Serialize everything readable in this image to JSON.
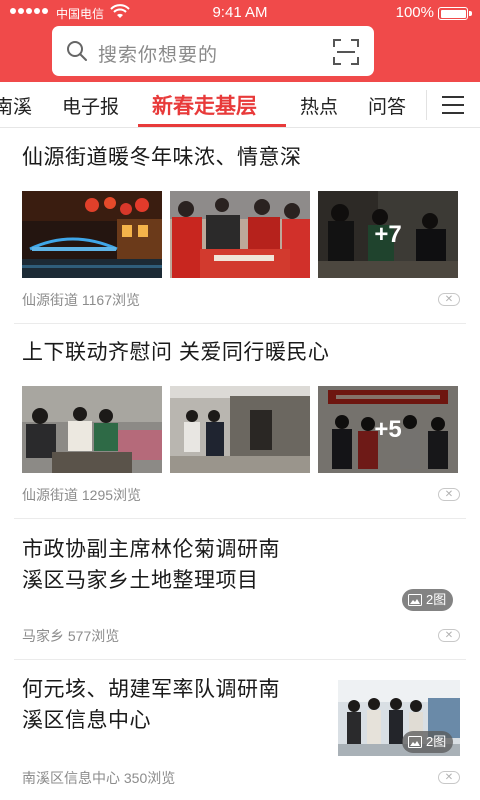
{
  "status_bar": {
    "carrier": "中国电信",
    "time": "9:41 AM",
    "battery": "100%",
    "battery_level": 1.0
  },
  "search": {
    "placeholder": "搜索你想要的",
    "search_icon": "search-icon",
    "scan_icon": "scan-icon"
  },
  "tabs": {
    "items": [
      {
        "label": "南溪"
      },
      {
        "label": "电子报"
      },
      {
        "label": "新春走基层"
      },
      {
        "label": "热点"
      },
      {
        "label": "问答"
      }
    ],
    "active_index": 2,
    "menu_icon": "menu-icon"
  },
  "colors": {
    "brand": "#f04a4a",
    "active_tab": "#e83a3a"
  },
  "news": [
    {
      "title": "仙源街道暖冬年味浓、情意深",
      "meta": "仙源街道 1167浏览",
      "more_count": "+7"
    },
    {
      "title": "上下联动齐慰问 关爱同行暖民心",
      "meta": "仙源街道 1295浏览",
      "more_count": "+5"
    },
    {
      "title_line1": "市政协副主席林伦菊调研南",
      "title_line2": "溪区马家乡土地整理项目",
      "meta": "马家乡 577浏览",
      "pic_count": "2图"
    },
    {
      "title_line1": "何元垓、胡建军率队调研南",
      "title_line2": "溪区信息中心",
      "meta": "南溪区信息中心 350浏览",
      "pic_count": "2图"
    }
  ],
  "dismiss_label": "✕"
}
